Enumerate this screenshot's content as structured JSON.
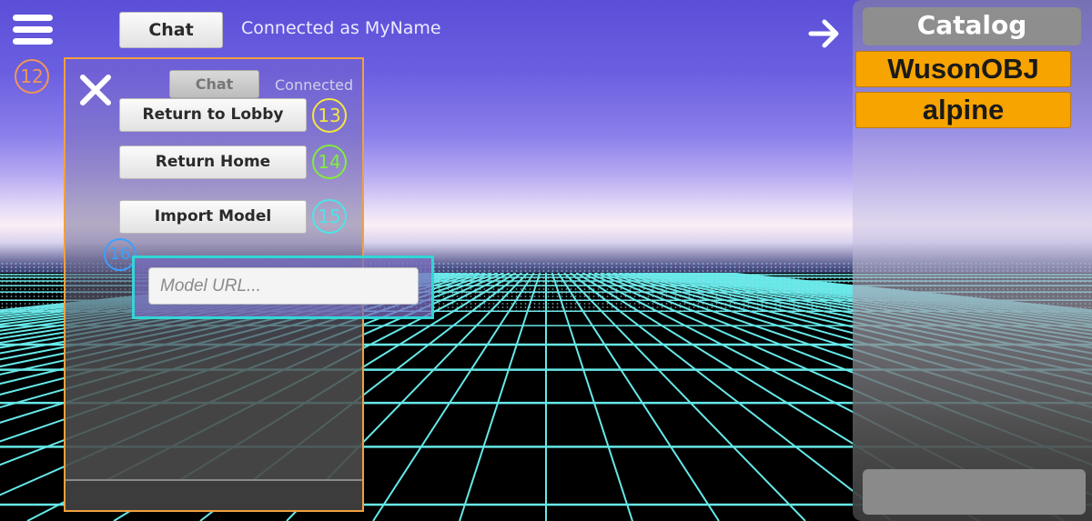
{
  "header": {
    "chat_label": "Chat",
    "status": "Connected as MyName",
    "menu_icon": "hamburger-menu-icon",
    "arrow_icon": "arrow-right-icon"
  },
  "badges": {
    "b12": "12",
    "b13": "13",
    "b14": "14",
    "b15": "15",
    "b16": "16"
  },
  "menu_panel": {
    "close_icon": "close-icon",
    "chat_tab": "Chat",
    "status": "Connected",
    "return_lobby": "Return to Lobby",
    "return_home": "Return Home",
    "import_model": "Import Model",
    "model_url_placeholder": "Model URL...",
    "model_url_value": ""
  },
  "catalog": {
    "title": "Catalog",
    "items": [
      {
        "label": "WusonOBJ"
      },
      {
        "label": "alpine"
      }
    ]
  },
  "colors": {
    "accent_orange": "#f7a300",
    "panel_border": "#f0a040",
    "url_highlight": "#32d6d6",
    "grid_line": "#66e8e8"
  }
}
